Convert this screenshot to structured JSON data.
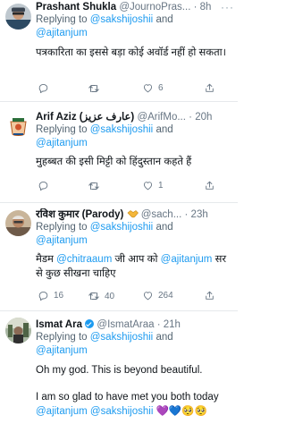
{
  "tweets": [
    {
      "name": "Prashant Shukla",
      "handle": "@JournoPras...",
      "time": "8h",
      "replying_prefix": "Replying to",
      "reply_mentions": [
        "@sakshijoshii",
        "@ajitanjum"
      ],
      "reply_and": "and",
      "text": "पत्रकारिता का इससे बड़ा कोई अवॉर्ड नहीं हो सकता।",
      "reply_count": "",
      "retweet_count": "",
      "like_count": "6"
    },
    {
      "name": "Arif Aziz (عارف عزیز)",
      "handle": "@ArifMo...",
      "time": "20h",
      "replying_prefix": "Replying to",
      "reply_mentions": [
        "@sakshijoshii",
        "@ajitanjum"
      ],
      "reply_and": "and",
      "text": "मुहब्बत की इसी मिट्टी को हिंदुस्तान कहते हैं",
      "reply_count": "",
      "retweet_count": "",
      "like_count": "1"
    },
    {
      "name": "रविश कुमार (Parody)",
      "handle": "@sach...",
      "time": "23h",
      "replying_prefix": "Replying to",
      "reply_mentions": [
        "@sakshijoshii",
        "@ajitanjum"
      ],
      "reply_and": "and",
      "text_parts": [
        "मैडम ",
        "@chitraaum",
        " जी आप को ",
        "@ajitanjum",
        " सर से कुछ सीखना चाहिए"
      ],
      "reply_count": "16",
      "retweet_count": "40",
      "like_count": "264"
    },
    {
      "name": "Ismat Ara",
      "handle": "@IsmatAraa",
      "time": "21h",
      "replying_prefix": "Replying to",
      "reply_mentions": [
        "@sakshijoshii",
        "@ajitanjum"
      ],
      "reply_and": "and",
      "text_line1": "Oh my god. This is beyond beautiful.",
      "text_line2": "I am so glad to have met you both today",
      "text_line3_mentions": [
        "@ajitanjum",
        "@sakshijoshii"
      ],
      "text_line3_emoji": "💜💙🥺🥺"
    }
  ],
  "more_glyph": "···",
  "dot": "·",
  "colors": {
    "accent": "#1d9bf0",
    "muted": "#687684",
    "divider": "#e6e9ec"
  },
  "icons": [
    "reply-icon",
    "retweet-icon",
    "like-icon",
    "share-icon",
    "verified-badge-icon",
    "handshake-emoji-icon"
  ]
}
